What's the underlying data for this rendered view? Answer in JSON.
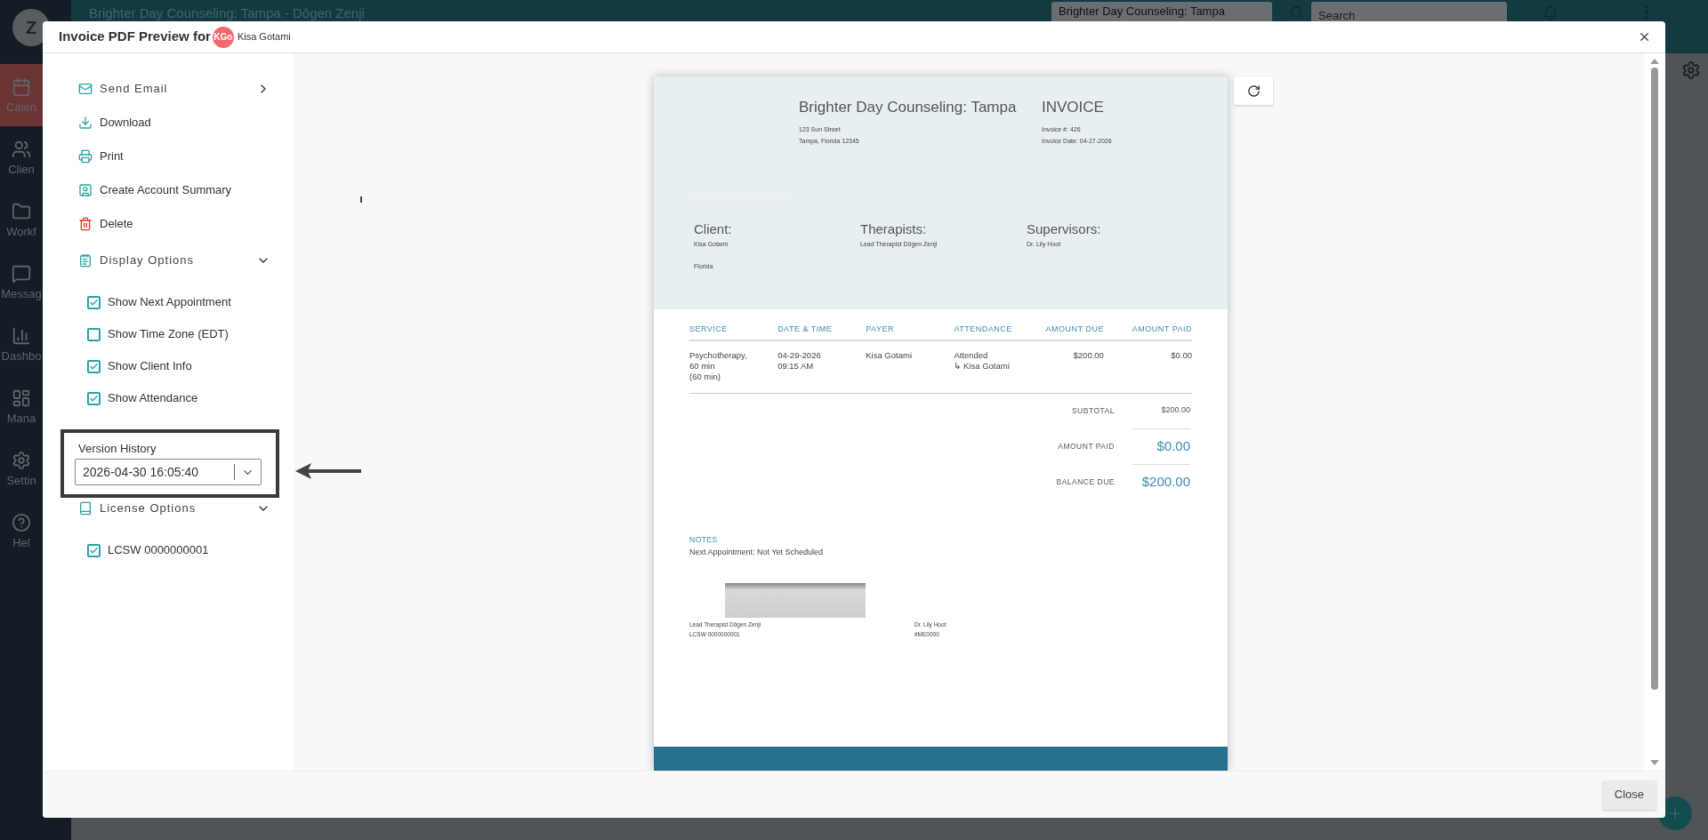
{
  "app": {
    "logo_letter": "Z",
    "title": "Brighter Day Counseling: Tampa - Dōgen Zenji",
    "location_select": "Brighter Day Counseling: Tampa",
    "search": {
      "placeholder": "Search"
    },
    "sidebar": [
      {
        "label": "Calen",
        "selected": true
      },
      {
        "label": "Clien",
        "selected": false
      },
      {
        "label": "Workf",
        "selected": false
      },
      {
        "label": "Messag",
        "selected": false
      },
      {
        "label": "Dashbo",
        "selected": false
      },
      {
        "label": "Mana",
        "selected": false
      },
      {
        "label": "Settin",
        "selected": false
      },
      {
        "label": "Hel",
        "selected": false
      }
    ]
  },
  "modal": {
    "title": "Invoice PDF Preview for",
    "client_badge": "KGo",
    "client_name": "Kisa Gotami",
    "close_button": "Close",
    "menu": [
      {
        "kind": "action",
        "label": "Send Email",
        "submenu": true,
        "danger": false
      },
      {
        "kind": "action",
        "label": "Download",
        "submenu": false,
        "danger": false
      },
      {
        "kind": "action",
        "label": "Print",
        "submenu": false,
        "danger": false
      },
      {
        "kind": "action",
        "label": "Create Account Summary",
        "submenu": false,
        "danger": false
      },
      {
        "kind": "action",
        "label": "Delete",
        "submenu": false,
        "danger": true
      },
      {
        "kind": "section",
        "label": "Display Options",
        "expanded": true,
        "children": [
          {
            "label": "Show Next Appointment",
            "checked": true
          },
          {
            "label": "Show Time Zone (EDT)",
            "checked": false
          },
          {
            "label": "Show Client Info",
            "checked": true
          },
          {
            "label": "Show Attendance",
            "checked": true
          }
        ]
      },
      {
        "kind": "version",
        "label": "Version History",
        "value": "2026-04-30 16:05:40",
        "highlighted": true
      },
      {
        "kind": "section",
        "label": "License Options",
        "expanded": true,
        "children": [
          {
            "label": "LCSW 0000000001",
            "checked": true
          }
        ]
      }
    ],
    "invoice": {
      "practice_name": "Brighter Day Counseling: Tampa",
      "address": [
        "123 Sun Street",
        "Tampa, Florida 12345"
      ],
      "doc_title": "INVOICE",
      "doc_meta": [
        "Invoice #: 426",
        "Invoice Date: 04-27-2026"
      ],
      "parties": [
        {
          "heading": "Client:",
          "lines": [
            "Kisa Gotami",
            "Florida"
          ]
        },
        {
          "heading": "Therapists:",
          "lines": [
            "Lead Therapist Dōgen Zenji"
          ]
        },
        {
          "heading": "Supervisors:",
          "lines": [
            "Dr. Lily Hoot"
          ]
        }
      ],
      "columns": [
        "SERVICE",
        "DATE & TIME",
        "PAYER",
        "ATTENDANCE",
        "AMOUNT DUE",
        "AMOUNT PAID"
      ],
      "rows": [
        {
          "service": [
            "Psychotherapy,",
            "60 min",
            "(60 min)"
          ],
          "date_time": [
            "04-29-2026",
            "09:15 AM"
          ],
          "payer": "Kisa Gotami",
          "attendance": "Attended",
          "attendee": "↳ Kisa Gotami",
          "amount_due": "$200.00",
          "amount_paid": "$0.00"
        }
      ],
      "totals": [
        {
          "label": "SUBTOTAL",
          "value": "$200.00",
          "emphasis": false
        },
        {
          "label": "AMOUNT PAID",
          "value": "$0.00",
          "emphasis": true
        },
        {
          "label": "BALANCE DUE",
          "value": "$200.00",
          "emphasis": true
        }
      ],
      "notes": {
        "heading": "NOTES",
        "text": "Next Appointment: Not Yet Scheduled"
      },
      "signatures": [
        {
          "has_image": true,
          "lines": [
            "Lead Therapist Dōgen Zenji",
            "LCSW 0000000001"
          ]
        },
        {
          "has_image": false,
          "lines": [
            "Dr. Lily Hoot",
            "#ME0000"
          ]
        }
      ]
    }
  }
}
